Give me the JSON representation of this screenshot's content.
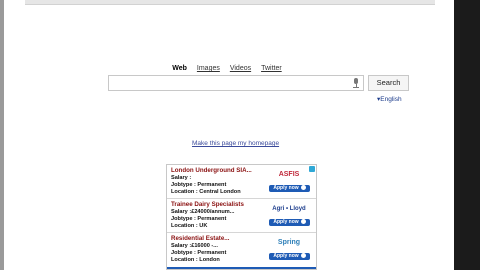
{
  "nav": {
    "items": [
      {
        "label": "Web",
        "active": true
      },
      {
        "label": "Images",
        "active": false
      },
      {
        "label": "Videos",
        "active": false
      },
      {
        "label": "Twitter",
        "active": false
      }
    ]
  },
  "search": {
    "button_label": "Search",
    "placeholder": "",
    "icon": "microphone-icon"
  },
  "language": {
    "label": "▾English"
  },
  "homepage_link": "Make this page my homepage",
  "ad": {
    "jobs": [
      {
        "title": "London Underground SIA...",
        "salary": "Salary :",
        "jobtype": "Jobtype : Permanent",
        "location": "Location : Central London",
        "logo": "ASFIS",
        "logo_color": "#c0283a",
        "apply": "Apply now"
      },
      {
        "title": "Trainee Dairy Specialists",
        "salary": "Salary :£24000/annum...",
        "jobtype": "Jobtype : Permanent",
        "location": "Location : UK",
        "logo": "Agri • Lloyd",
        "logo_color": "#1b3c8c",
        "apply": "Apply now"
      },
      {
        "title": "Residential Estate...",
        "salary": "Salary :£16000 -...",
        "jobtype": "Jobtype : Permanent",
        "location": "Location : London",
        "logo": "Spring",
        "logo_color": "#2d7fb8",
        "apply": "Apply now"
      }
    ]
  },
  "colors": {
    "accent_blue": "#1e5bb5",
    "job_title": "#8a1010"
  }
}
